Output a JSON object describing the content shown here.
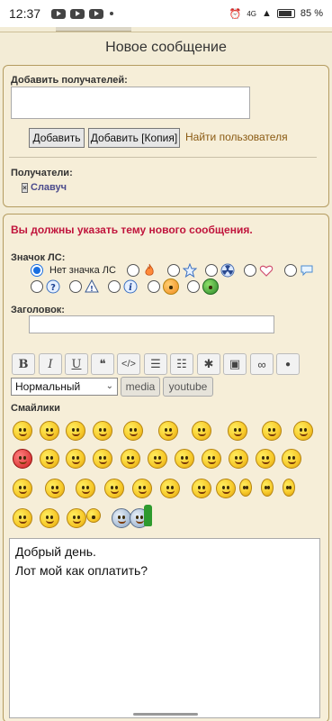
{
  "status": {
    "time": "12:37",
    "network": "4G",
    "battery": "85 %"
  },
  "page": {
    "title": "Новое сообщение"
  },
  "recipients_section": {
    "add_label": "Добавить получателей:",
    "add_button": "Добавить",
    "add_copy_button": "Добавить [Копия]",
    "find_users_link": "Найти пользователя",
    "recipients_label": "Получатели:",
    "recipient_name": "Славуч",
    "remove_glyph": "×"
  },
  "compose": {
    "error": "Вы должны указать тему нового сообщения.",
    "icon_label": "Значок ЛС:",
    "no_icon_label": "Нет значка ЛС",
    "subject_label": "Заголовок:",
    "subject_value": "",
    "font_size_select": "Нормальный",
    "media_button": "media",
    "youtube_button": "youtube",
    "smilies_label": "Смайлики",
    "message_line1": "Добрый день.",
    "message_line2": "Лот мой как оплатить?"
  },
  "toolbar": {
    "bold": "B",
    "italic": "I",
    "underline": "U",
    "quote": "❝",
    "code": "</>",
    "list": "☰",
    "list_numbered": "☷",
    "asterisk": "✱",
    "image": "▣",
    "link": "∞",
    "drop": "●"
  },
  "colors": {
    "accent_error": "#c0143c",
    "link": "#8a5a12",
    "panel_border": "#b49c60",
    "background": "#f3ecd6"
  }
}
